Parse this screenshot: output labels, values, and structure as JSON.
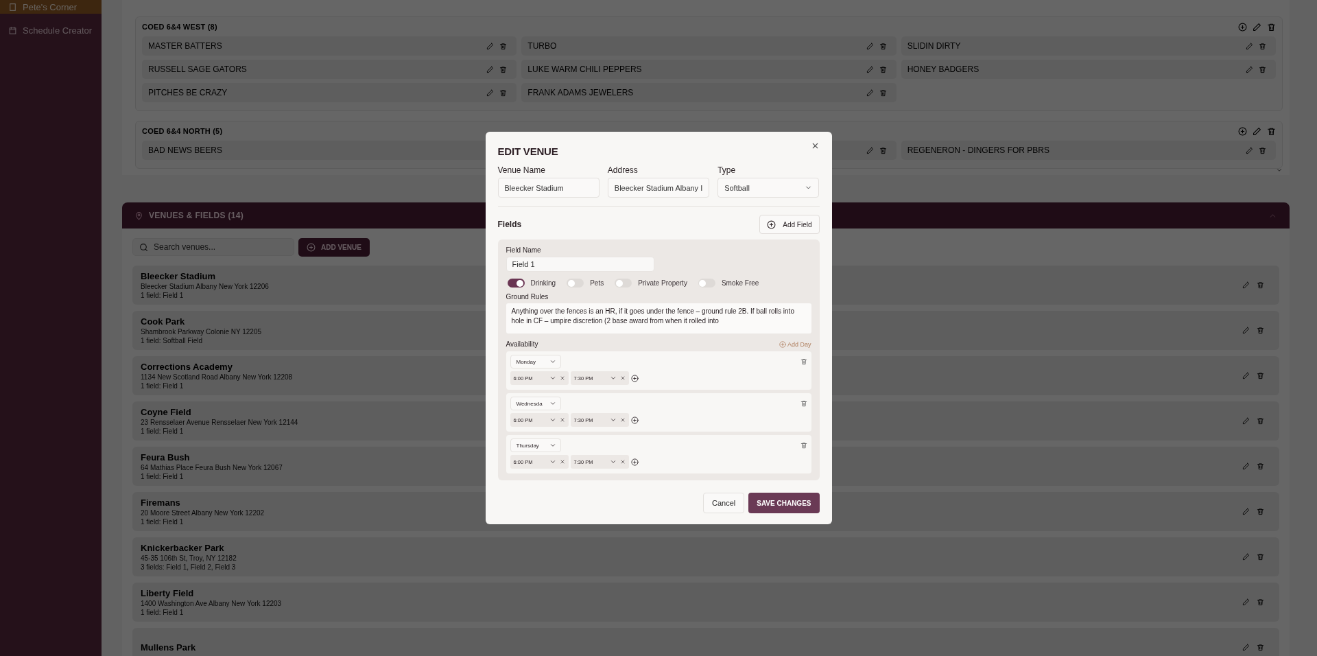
{
  "sidebar": {
    "items": [
      {
        "label": "Pete's Corner",
        "selected": true
      },
      {
        "label": "Schedule Creator",
        "selected": false
      }
    ]
  },
  "divisions": [
    {
      "title": "COED 6&4 WEST (8)",
      "teams": [
        {
          "kind": "team",
          "name": "MASTER BATTERS"
        },
        {
          "kind": "team",
          "name": "TURBO"
        },
        {
          "kind": "team",
          "name": "SLIDIN DIRTY"
        },
        {
          "kind": "team",
          "name": "RUSSELL SAGE GATORS"
        },
        {
          "kind": "team",
          "name": "LUKE WARM CHILI PEPPERS"
        },
        {
          "kind": "team",
          "name": "HONEY BADGERS"
        },
        {
          "kind": "team",
          "name": "PITCHES BE CRAZY"
        },
        {
          "kind": "team",
          "name": "FRANK ADAMS JEWELERS"
        }
      ]
    },
    {
      "title": "COED 6&4 NORTH (5)",
      "teams": [
        {
          "kind": "team",
          "name": "BAD NEWS BEERS"
        },
        {
          "kind": "covered"
        },
        {
          "kind": "team",
          "name": "REGENERON - DINGERS FOR PBRS"
        }
      ]
    }
  ],
  "venues": {
    "title": "VENUES & FIELDS (14)",
    "search": {
      "placeholder": "Search venues..."
    },
    "add_button": "ADD VENUE",
    "items": [
      {
        "name": "Bleecker Stadium",
        "address": "Bleecker Stadium Albany New York 12206",
        "fields": "1 field: Field 1"
      },
      {
        "name": "Cook Park",
        "address": "Shambrook Parkway Colonie NY 12205",
        "fields": "1 field: Softball Field"
      },
      {
        "name": "Corrections Academy",
        "address": "1134 New Scotland Road Albany New York 12208",
        "fields": "1 field: Field 1"
      },
      {
        "name": "Coyne Field",
        "address": "23 Rensselaer Avenue Rensselaer New York 12144",
        "fields": "1 field: Field 1"
      },
      {
        "name": "Feura Bush",
        "address": "64 Mathias Place Feura Bush New York 12067",
        "fields": "1 field: Field 1"
      },
      {
        "name": "Firemans",
        "address": "20 Moore Street Albany New York 12202",
        "fields": "1 field: Field 1"
      },
      {
        "name": "Knickerbacker Park",
        "address": "45-35 106th St, Troy, NY 12182",
        "fields": "3 fields: Field 1, Field 2, Field 3"
      },
      {
        "name": "Liberty Field",
        "address": "1400 Washington Ave Albany New York 12203",
        "fields": "1 field: Field 1"
      },
      {
        "name": "Mullens Park"
      }
    ]
  },
  "modal": {
    "title": "EDIT VENUE",
    "inputs": [
      {
        "kind": "text",
        "label": "Venue Name",
        "value": "Bleecker Stadium"
      },
      {
        "kind": "text",
        "label": "Address",
        "value": "Bleecker Stadium Albany I"
      },
      {
        "kind": "select",
        "label": "Type",
        "value": "Softball"
      }
    ],
    "fields_heading": "Fields",
    "add_field": "Add Field",
    "field": {
      "name_label": "Field Name",
      "name": "Field 1",
      "toggles": [
        {
          "label": "Drinking",
          "on": true
        },
        {
          "label": "Pets",
          "on": false
        },
        {
          "label": "Private Property",
          "on": false
        },
        {
          "label": "Smoke Free",
          "on": false
        }
      ],
      "rules_label": "Ground Rules",
      "rules": "Anything over the fences is an HR, if it goes under the fence – ground rule 2B. If ball rolls into hole in CF – umpire discretion (2 base award from when it rolled into",
      "availability_label": "Availability",
      "add_day": "Add Day",
      "days": [
        {
          "day": "Monday",
          "slots": [
            {
              "start": "6:00 PM",
              "end": "7:30 PM"
            }
          ]
        },
        {
          "day": "Wednesda",
          "slots": [
            {
              "start": "6:00 PM",
              "end": "7:30 PM"
            }
          ]
        },
        {
          "day": "Thursday",
          "slots": [
            {
              "start": "6:00 PM",
              "end": "7:30 PM"
            }
          ]
        }
      ]
    },
    "buttons": {
      "cancel": "Cancel",
      "save": "SAVE CHANGES"
    }
  }
}
